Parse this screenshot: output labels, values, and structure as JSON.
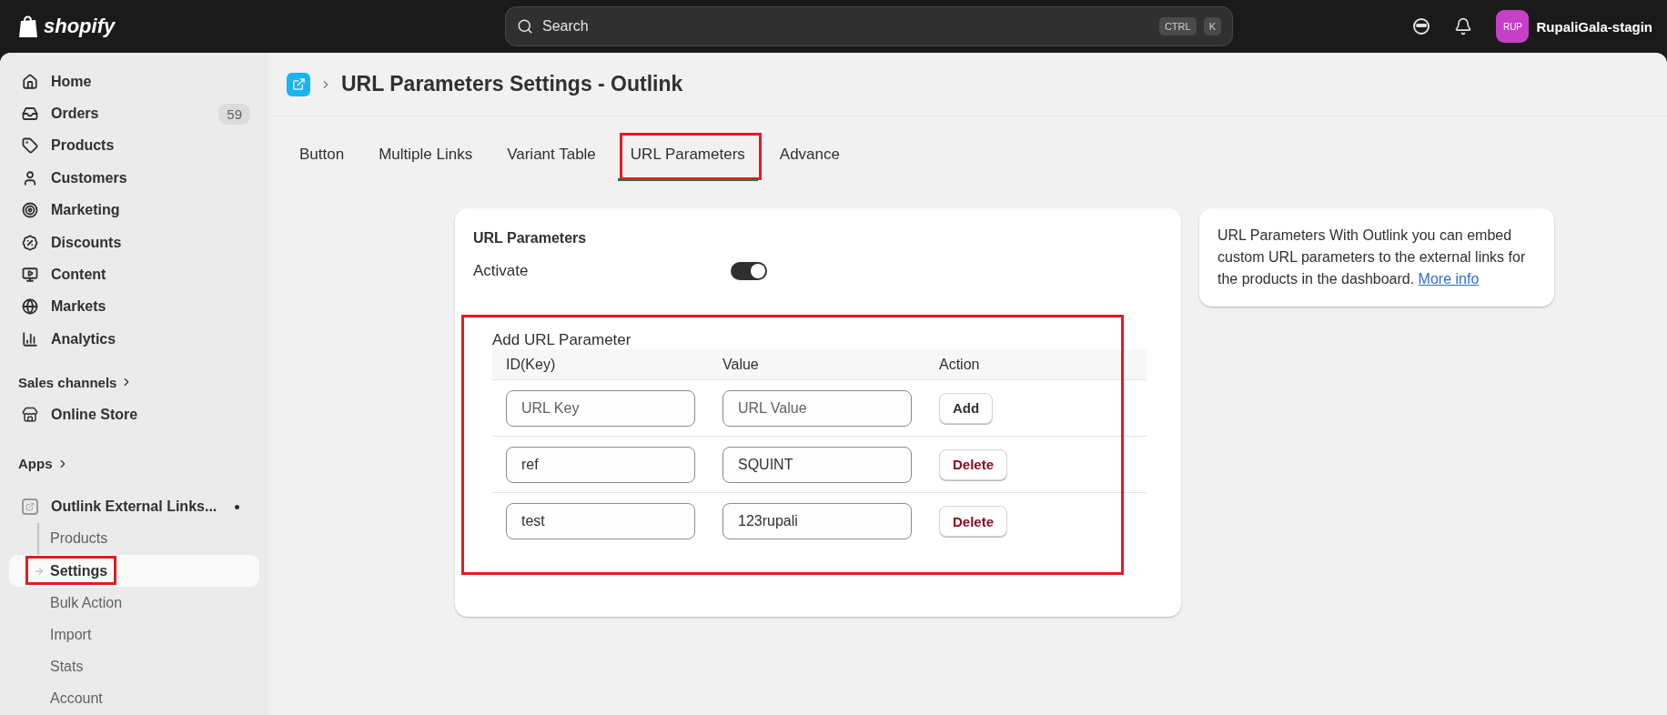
{
  "topbar": {
    "logo": "shopify",
    "search": {
      "placeholder": "Search"
    },
    "shortcut": [
      "CTRL",
      "K"
    ],
    "avatar": "RUP",
    "store": "RupaliGala-stagin"
  },
  "sidebar": {
    "items": [
      {
        "label": "Home"
      },
      {
        "label": "Orders",
        "badge": "59"
      },
      {
        "label": "Products"
      },
      {
        "label": "Customers"
      },
      {
        "label": "Marketing"
      },
      {
        "label": "Discounts"
      },
      {
        "label": "Content"
      },
      {
        "label": "Markets"
      },
      {
        "label": "Analytics"
      }
    ],
    "sales_channels": {
      "heading": "Sales channels",
      "items": [
        {
          "label": "Online Store"
        }
      ]
    },
    "apps": {
      "heading": "Apps",
      "app": {
        "label": "Outlink External Links...",
        "children": [
          {
            "label": "Products",
            "selected": false,
            "highlighted": false
          },
          {
            "label": "Settings",
            "selected": true,
            "highlighted": true
          },
          {
            "label": "Bulk Action",
            "selected": false,
            "highlighted": false
          },
          {
            "label": "Import",
            "selected": false,
            "highlighted": false
          },
          {
            "label": "Stats",
            "selected": false,
            "highlighted": false
          },
          {
            "label": "Account",
            "selected": false,
            "highlighted": false
          }
        ]
      }
    }
  },
  "page": {
    "title": "URL Parameters Settings - Outlink",
    "tabs": [
      {
        "label": "Button",
        "selected": false,
        "highlighted": false
      },
      {
        "label": "Multiple Links",
        "selected": false,
        "highlighted": false
      },
      {
        "label": "Variant Table",
        "selected": false,
        "highlighted": false
      },
      {
        "label": "URL Parameters",
        "selected": true,
        "highlighted": true
      },
      {
        "label": "Advance",
        "selected": false,
        "highlighted": false
      }
    ],
    "card": {
      "title": "URL Parameters",
      "activate": {
        "label": "Activate",
        "on": true
      },
      "parameters": {
        "title": "Add URL Parameter",
        "highlighted": true,
        "columns": [
          "ID(Key)",
          "Value",
          "Action"
        ],
        "rows": [
          {
            "kind": "new",
            "key": {
              "placeholder": "URL Key"
            },
            "value": {
              "placeholder": "URL Value"
            },
            "action": "Add"
          },
          {
            "kind": "existing",
            "key": {
              "value": "ref"
            },
            "value": {
              "value": "SQUINT"
            },
            "action": "Delete"
          },
          {
            "kind": "existing",
            "key": {
              "value": "test"
            },
            "value": {
              "value": "123rupali"
            },
            "action": "Delete"
          }
        ]
      }
    },
    "info": {
      "text": "URL Parameters With Outlink you can embed custom URL parameters to the external links for the products in the dashboard.",
      "link": "More info"
    }
  }
}
